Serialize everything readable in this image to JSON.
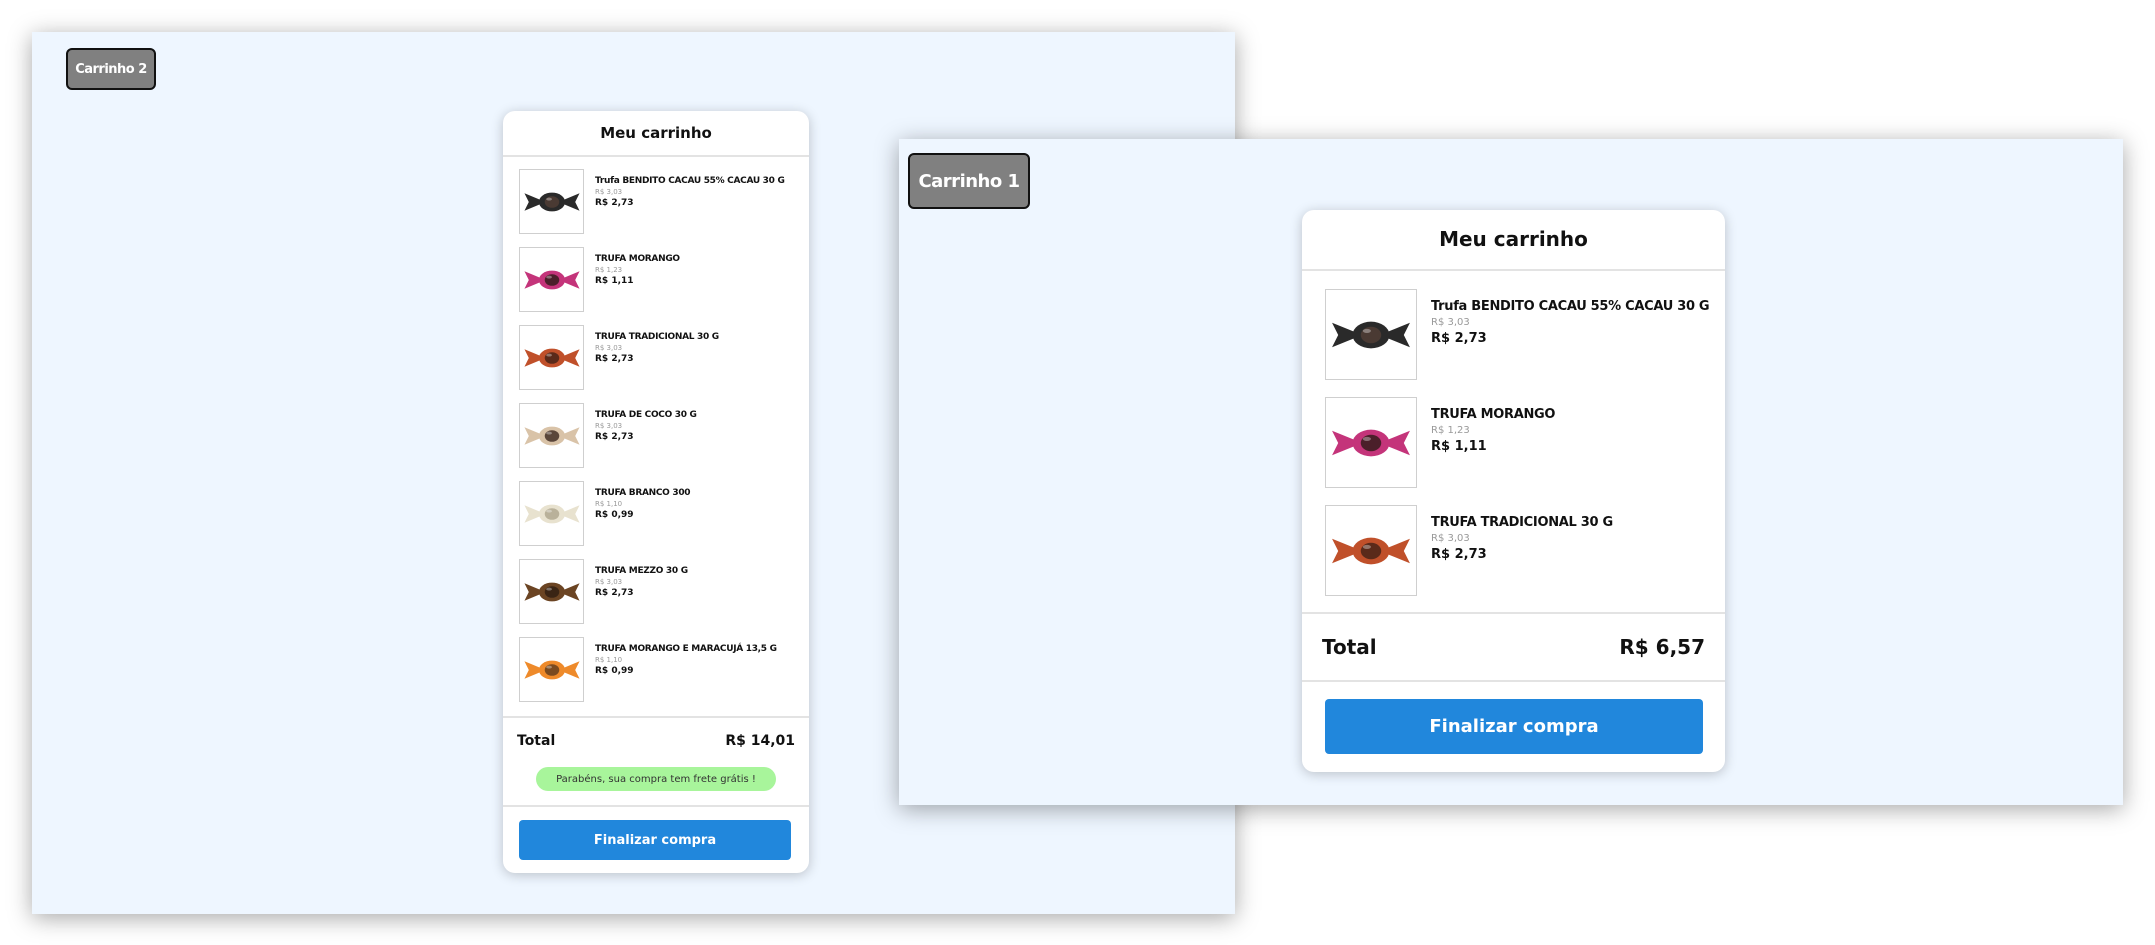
{
  "colors": {
    "accent": "#2187dc",
    "frete_badge": "#a8f59b",
    "tag_bg": "#808080",
    "screen_bg": "#eef6ff"
  },
  "carrinho2": {
    "tag": "Carrinho 2",
    "title": "Meu carrinho",
    "items": [
      {
        "name": "Trufa BENDITO CACAU 55% CACAU 30 G",
        "old_price": "R$ 3,03",
        "price": "R$ 2,73",
        "wrapper": "#2a2a2a",
        "center": "#4a3a33"
      },
      {
        "name": "TRUFA MORANGO",
        "old_price": "R$ 1,23",
        "price": "R$ 1,11",
        "wrapper": "#c4347a",
        "center": "#4b1f2a"
      },
      {
        "name": "TRUFA TRADICIONAL 30 G",
        "old_price": "R$ 3,03",
        "price": "R$ 2,73",
        "wrapper": "#c0502a",
        "center": "#5a2a1a"
      },
      {
        "name": "TRUFA DE COCO 30 G",
        "old_price": "R$ 3,03",
        "price": "R$ 2,73",
        "wrapper": "#d9c3a8",
        "center": "#5a463a"
      },
      {
        "name": "TRUFA BRANCO 300",
        "old_price": "R$ 1,10",
        "price": "R$ 0,99",
        "wrapper": "#e8e2cf",
        "center": "#b9b19a"
      },
      {
        "name": "TRUFA MEZZO 30 G",
        "old_price": "R$ 3,03",
        "price": "R$ 2,73",
        "wrapper": "#6b4423",
        "center": "#3a2414"
      },
      {
        "name": "TRUFA MORANGO E MARACUJÁ 13,5 G",
        "old_price": "R$ 1,10",
        "price": "R$ 0,99",
        "wrapper": "#ee8a2a",
        "center": "#7a4a1f"
      }
    ],
    "total_label": "Total",
    "total_value": "R$ 14,01",
    "frete_msg": "Parabéns, sua compra tem frete grátis !",
    "checkout_label": "Finalizar compra"
  },
  "carrinho1": {
    "tag": "Carrinho 1",
    "title": "Meu carrinho",
    "items": [
      {
        "name": "Trufa BENDITO CACAU 55% CACAU 30 G",
        "old_price": "R$ 3,03",
        "price": "R$ 2,73",
        "wrapper": "#2a2a2a",
        "center": "#4a3a33"
      },
      {
        "name": "TRUFA MORANGO",
        "old_price": "R$ 1,23",
        "price": "R$ 1,11",
        "wrapper": "#c4347a",
        "center": "#4b1f2a"
      },
      {
        "name": "TRUFA TRADICIONAL 30 G",
        "old_price": "R$ 3,03",
        "price": "R$ 2,73",
        "wrapper": "#c0502a",
        "center": "#5a2a1a"
      }
    ],
    "total_label": "Total",
    "total_value": "R$ 6,57",
    "checkout_label": "Finalizar compra"
  }
}
